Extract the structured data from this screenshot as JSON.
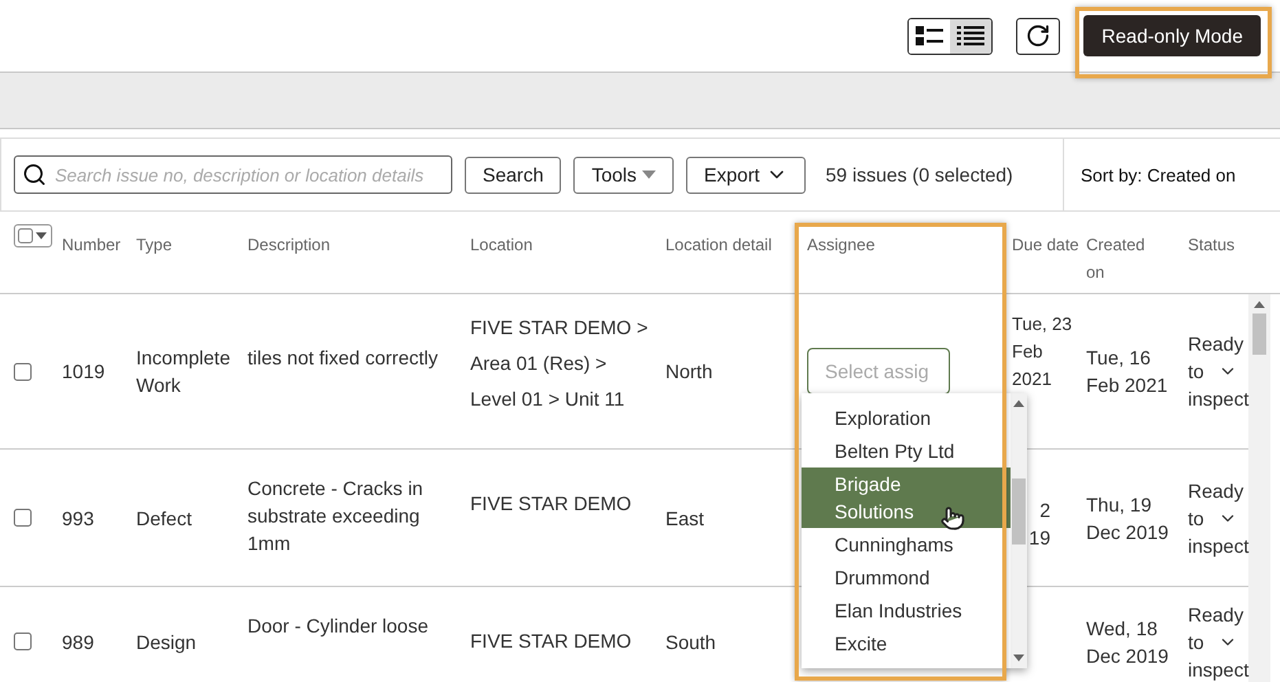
{
  "toolbar": {
    "view_modes": [
      {
        "kind": "detail",
        "selected": false
      },
      {
        "kind": "list",
        "selected": true
      }
    ],
    "read_only_button": "Read-only Mode"
  },
  "search": {
    "placeholder": "Search issue no, description or location details",
    "button": "Search"
  },
  "select_all": {
    "checked": false
  },
  "tools": "Tools",
  "export": "Export",
  "count": "59 issues (0 selected)",
  "sort": "Sort by: Created on",
  "columns": [
    "Number",
    "Type",
    "Description",
    "Location",
    "Location detail",
    "Assignee",
    "Due date",
    "Created on",
    "Status"
  ],
  "rows": [
    {
      "checked": false,
      "number": "1019",
      "type": "Incomplete Work",
      "description": "tiles not fixed correctly",
      "location": "FIVE STAR DEMO > Area 01 (Res) > Level 01 > Unit 11",
      "location_detail": "North",
      "due_date": "Tue, 23 Feb 2021",
      "created_on": "Tue, 16 Feb 2021",
      "status": "Ready to inspect"
    },
    {
      "checked": false,
      "number": "993",
      "type": "Defect",
      "description": "Concrete - Cracks in substrate exceeding 1mm",
      "location": "FIVE STAR DEMO",
      "location_detail": "East",
      "due_date": "2\n19",
      "created_on": "Thu, 19 Dec 2019",
      "status": "Ready to inspect"
    },
    {
      "checked": false,
      "number": "989",
      "type": "Design",
      "description": "Door - Cylinder loose",
      "location": "FIVE STAR DEMO",
      "location_detail": "South",
      "created_on": "Wed, 18 Dec 2019",
      "status": "Ready to inspect"
    }
  ],
  "assignee_picker": {
    "placeholder": "Select assig",
    "items": [
      {
        "label": "Exploration",
        "selected": false
      },
      {
        "label": "Belten Pty Ltd",
        "selected": false
      },
      {
        "label": "Brigade Solutions",
        "selected": true
      },
      {
        "label": "Cunninghams",
        "selected": false
      },
      {
        "label": "Drummond",
        "selected": false
      },
      {
        "label": "Elan Industries",
        "selected": false
      },
      {
        "label": "Excite",
        "selected": false
      }
    ]
  }
}
